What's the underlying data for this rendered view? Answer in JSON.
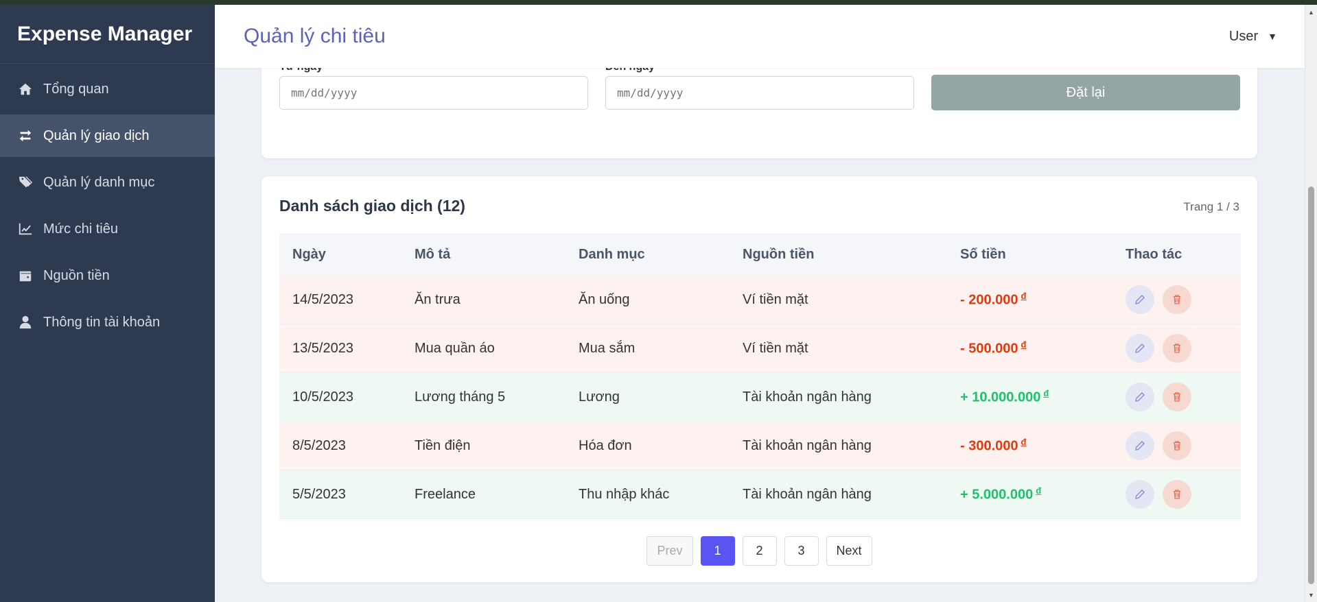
{
  "sidebar": {
    "brand": "Expense Manager",
    "items": [
      {
        "label": "Tổng quan",
        "icon": "home-icon"
      },
      {
        "label": "Quản lý giao dịch",
        "icon": "swap-icon",
        "active": true
      },
      {
        "label": "Quản lý danh mục",
        "icon": "tags-icon"
      },
      {
        "label": "Mức chi tiêu",
        "icon": "chart-line-icon"
      },
      {
        "label": "Nguồn tiền",
        "icon": "wallet-icon"
      },
      {
        "label": "Thông tin tài khoản",
        "icon": "user-icon"
      }
    ]
  },
  "header": {
    "title": "Quản lý chi tiêu",
    "user_label": "User",
    "caret": "▼"
  },
  "filters": {
    "from_label": "Từ ngày",
    "to_label": "Đến ngày",
    "from_placeholder": "mm/dd/yyyy",
    "to_placeholder": "mm/dd/yyyy",
    "reset_label": "Đặt lại"
  },
  "transactions": {
    "title": "Danh sách giao dịch (12)",
    "page_info": "Trang 1 / 3",
    "columns": [
      "Ngày",
      "Mô tả",
      "Danh mục",
      "Nguồn tiền",
      "Số tiền",
      "Thao tác"
    ],
    "currency_symbol": "đ",
    "rows": [
      {
        "date": "14/5/2023",
        "desc": "Ăn trưa",
        "category": "Ăn uống",
        "source": "Ví tiền mặt",
        "amount": "- 200.000",
        "type": "expense"
      },
      {
        "date": "13/5/2023",
        "desc": "Mua quần áo",
        "category": "Mua sắm",
        "source": "Ví tiền mặt",
        "amount": "- 500.000",
        "type": "expense"
      },
      {
        "date": "10/5/2023",
        "desc": "Lương tháng 5",
        "category": "Lương",
        "source": "Tài khoản ngân hàng",
        "amount": "+ 10.000.000",
        "type": "income"
      },
      {
        "date": "8/5/2023",
        "desc": "Tiền điện",
        "category": "Hóa đơn",
        "source": "Tài khoản ngân hàng",
        "amount": "- 300.000",
        "type": "expense"
      },
      {
        "date": "5/5/2023",
        "desc": "Freelance",
        "category": "Thu nhập khác",
        "source": "Tài khoản ngân hàng",
        "amount": "+ 5.000.000",
        "type": "income"
      }
    ]
  },
  "pagination": {
    "prev": "Prev",
    "pages": [
      "1",
      "2",
      "3"
    ],
    "current": "1",
    "next": "Next"
  },
  "colors": {
    "sidebar_bg": "#2e3a50",
    "accent": "#5a55f2",
    "title": "#5b63b7",
    "expense": "#e03b10",
    "income": "#1ec26a"
  }
}
